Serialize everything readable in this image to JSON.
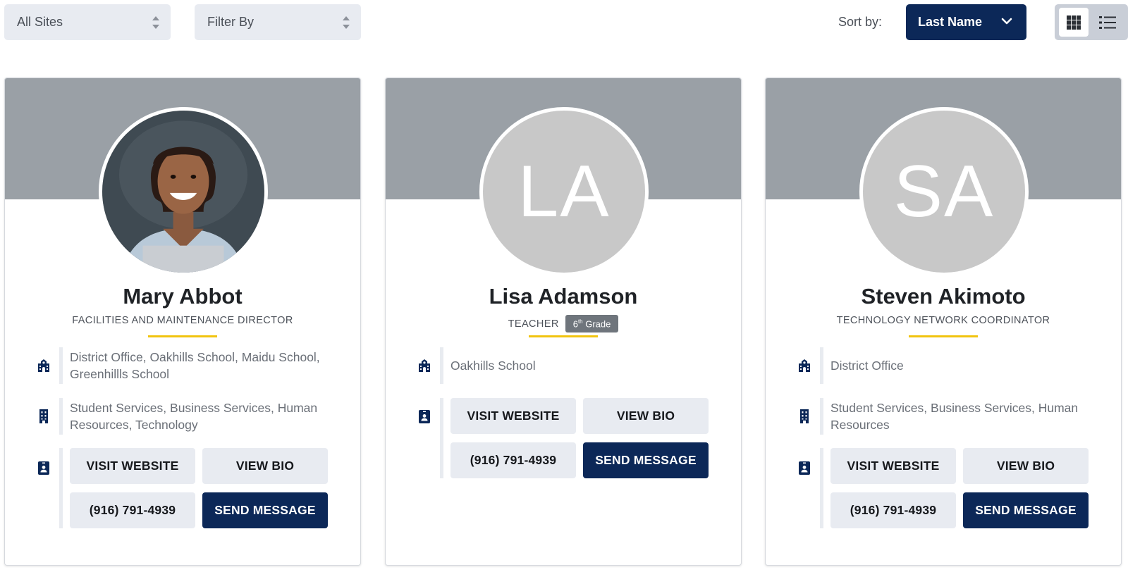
{
  "filters": {
    "sites_label": "All Sites",
    "filter_label": "Filter By",
    "sort_label": "Sort by:",
    "sort_value": "Last Name"
  },
  "colors": {
    "navy": "#0c2858",
    "banner": "#9aa0a6",
    "accent": "#f1c40f",
    "button_bg": "#e8ebf1"
  },
  "cards": [
    {
      "name": "Mary Abbot",
      "role": "FACILITIES AND MAINTENANCE DIRECTOR",
      "photo": "portrait-photo",
      "schools": "District Office, Oakhills School, Maidu School, Greenhillls School",
      "departments": "Student Services, Business Services, Human Resources, Technology",
      "visit_label": "VISIT WEBSITE",
      "bio_label": "VIEW BIO",
      "phone": "(916) 791-4939",
      "message_label": "SEND MESSAGE"
    },
    {
      "name": "Lisa Adamson",
      "initials": "LA",
      "role": "TEACHER",
      "grade_num": "6",
      "grade_sup": "th",
      "grade_word": "Grade",
      "schools": "Oakhills School",
      "visit_label": "VISIT WEBSITE",
      "bio_label": "VIEW BIO",
      "phone": "(916) 791-4939",
      "message_label": "SEND MESSAGE"
    },
    {
      "name": "Steven Akimoto",
      "initials": "SA",
      "role": "TECHNOLOGY NETWORK COORDINATOR",
      "schools": "District Office",
      "departments": "Student Services, Business Services, Human Resources",
      "visit_label": "VISIT WEBSITE",
      "bio_label": "VIEW BIO",
      "phone": "(916) 791-4939",
      "message_label": "SEND MESSAGE"
    }
  ]
}
